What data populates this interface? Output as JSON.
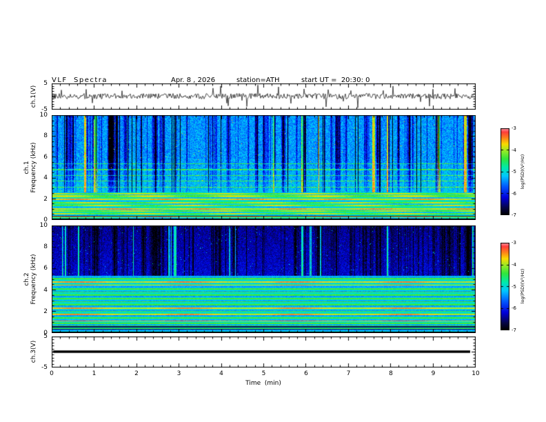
{
  "header": {
    "title": "VLF  Spectra",
    "date": "Apr. 8 , 2026",
    "station": "station=ATH",
    "start_ut": "start UT =  20:30: 0"
  },
  "xaxis": {
    "label": "Time  (min)",
    "ticks": [
      "0",
      "1",
      "2",
      "3",
      "4",
      "5",
      "6",
      "7",
      "8",
      "9",
      "10"
    ],
    "min": 0,
    "max": 10
  },
  "panels": {
    "wave": {
      "ylabel": "ch.1(V)",
      "yticks": [
        "5",
        "-5"
      ]
    },
    "spec1": {
      "ylabel_line1": "ch.1",
      "ylabel_line2": "Frequency (kHz)",
      "yticks": [
        "10",
        "8",
        "6",
        "4",
        "2",
        "0"
      ]
    },
    "spec2": {
      "ylabel_line1": "ch.2",
      "ylabel_line2": "Frequency (kHz)",
      "yticks": [
        "10",
        "8",
        "6",
        "4",
        "2",
        "0"
      ]
    },
    "ch3": {
      "ylabel": "ch.3(V)",
      "yticks": [
        "5",
        "-5"
      ]
    }
  },
  "colorbars": [
    {
      "id": "cb1",
      "ticks": [
        "-3",
        "-4",
        "-5",
        "-6",
        "-7"
      ],
      "label": "log(PSD)(V²/Hz)"
    },
    {
      "id": "cb2",
      "ticks": [
        "-3",
        "-4",
        "-5",
        "-6",
        "-7"
      ],
      "label": "log(PSD)(V²/Hz)"
    }
  ],
  "colormap": {
    "stops": [
      [
        0.0,
        0,
        0,
        0
      ],
      [
        0.08,
        5,
        5,
        70
      ],
      [
        0.2,
        0,
        0,
        220
      ],
      [
        0.33,
        0,
        90,
        255
      ],
      [
        0.45,
        0,
        200,
        255
      ],
      [
        0.55,
        0,
        235,
        170
      ],
      [
        0.65,
        50,
        230,
        60
      ],
      [
        0.74,
        150,
        235,
        40
      ],
      [
        0.82,
        250,
        220,
        0
      ],
      [
        0.9,
        255,
        120,
        30
      ],
      [
        0.96,
        255,
        60,
        60
      ],
      [
        1.0,
        255,
        150,
        160
      ]
    ]
  },
  "chart_data": [
    {
      "type": "line",
      "panel": "ch1_waveform",
      "title": "ch.1 voltage time series",
      "xlabel": "Time (min)",
      "ylabel": "ch.1(V)",
      "xlim": [
        0,
        10
      ],
      "ylim": [
        -5,
        5
      ],
      "noise_amp": 1.1,
      "spike_prob": 0.035,
      "spike_amp": 3.2,
      "line_color": "#000000",
      "description": "broadband noise around 0 V with frequent impulsive spikes up to about ±4 V across the full 0–10 min record"
    },
    {
      "type": "heatmap",
      "panel": "ch1_spectrogram",
      "ylabel": "ch.1 Frequency (kHz)",
      "xlim": [
        0,
        10
      ],
      "ylim": [
        0,
        10
      ],
      "zlabel": "log(PSD)(V²/Hz)",
      "zlim": [
        -7,
        -3
      ],
      "base_level": -5.0,
      "black_band_top_khz": 0.12,
      "low_band_top_khz": 2.6,
      "bright_lines_khz": [
        0.3,
        0.55,
        0.8,
        1.05,
        1.35,
        1.65,
        1.95,
        2.25,
        2.5
      ],
      "bright_line_level": -4.1,
      "dark_lines_khz": [
        0.32
      ],
      "mid_lines_khz": [
        3.1,
        3.7,
        4.25,
        4.8,
        5.35
      ],
      "mid_line_boost": 0.9,
      "streak_strength": 1.9,
      "green_gap_prob": 0.015,
      "description": "green/cyan background with dense dark-blue vertical sferic streaks above ~3 kHz, light horizontal lines near 3–5.5 kHz, bright yellow interference lines below ~2.6 kHz, black band at 0 kHz"
    },
    {
      "type": "heatmap",
      "panel": "ch2_spectrogram",
      "ylabel": "ch.2 Frequency (kHz)",
      "xlim": [
        0,
        10
      ],
      "ylim": [
        0,
        10
      ],
      "zlabel": "log(PSD)(V²/Hz)",
      "zlim": [
        -7,
        -3
      ],
      "base_level": -5.1,
      "black_band_top_khz": 0.1,
      "dark_band_bottom_khz": 5.3,
      "bright_lines_khz": [
        0.35,
        0.6,
        0.85,
        1.1,
        1.4,
        1.7,
        2.0,
        2.3,
        2.6,
        2.9,
        3.2,
        3.5,
        3.8,
        4.1,
        4.45,
        4.75,
        5.05
      ],
      "hot_lines_khz": [
        1.1,
        1.7,
        2.3,
        4.45,
        4.75
      ],
      "hot_line_level": -3.7,
      "line_level": -4.35,
      "dark_lines_khz": [
        0.3,
        0.55
      ],
      "streak_strength": 0.7,
      "green_gap_prob": 0.02,
      "description": "dark-blue region above ~5.3 kHz with vertical streaks and occasional green gaps; green region below with many yellow/orange horizontal interference lines; black band at 0 kHz"
    },
    {
      "type": "line",
      "panel": "ch3_flat",
      "ylabel": "ch.3(V)",
      "xlim": [
        0,
        10
      ],
      "ylim": [
        -5,
        5
      ],
      "constant_value": 0,
      "line_width": 3.5,
      "line_color": "#000000",
      "description": "flat thick line at 0 V (channel inactive)"
    }
  ]
}
